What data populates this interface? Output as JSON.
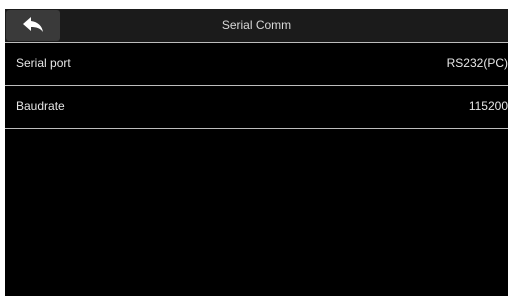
{
  "header": {
    "title": "Serial Comm",
    "back_icon": "back-arrow-icon"
  },
  "settings": [
    {
      "label": "Serial port",
      "value": "RS232(PC)"
    },
    {
      "label": "Baudrate",
      "value": "115200"
    }
  ],
  "colors": {
    "background": "#000000",
    "header": "#1b1b1b",
    "back_button": "#3a3a3a",
    "text": "#e6e6e6",
    "divider": "#bdbdbd"
  }
}
